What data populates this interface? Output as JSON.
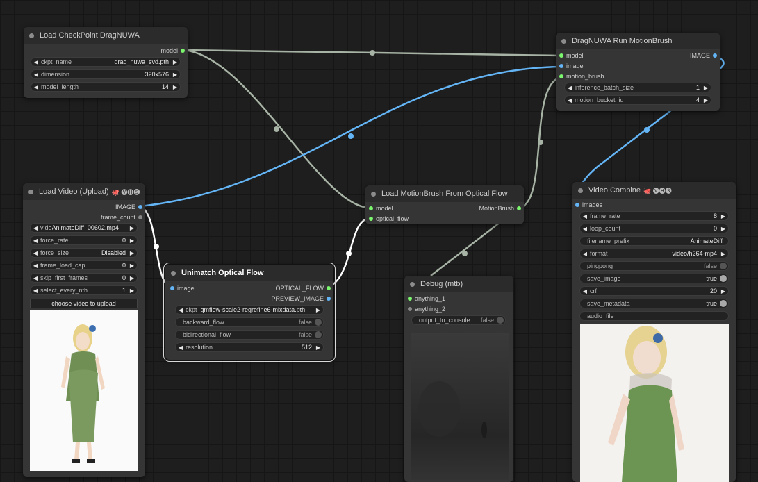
{
  "nodes": {
    "load_checkpoint": {
      "title": "Load CheckPoint DragNUWA",
      "outputs": [
        "model"
      ],
      "widgets": [
        {
          "label": "ckpt_name",
          "value": "drag_nuwa_svd.pth"
        },
        {
          "label": "dimension",
          "value": "320x576"
        },
        {
          "label": "model_length",
          "value": "14"
        }
      ]
    },
    "drag_run": {
      "title": "DragNUWA Run MotionBrush",
      "inputs": [
        "model",
        "image",
        "motion_brush"
      ],
      "outputs": [
        "IMAGE"
      ],
      "widgets": [
        {
          "label": "inference_batch_size",
          "value": "1"
        },
        {
          "label": "motion_bucket_id",
          "value": "4"
        }
      ]
    },
    "load_video": {
      "title": "Load Video (Upload)",
      "badge": "🐙 🅥🅗🅢",
      "outputs": [
        "IMAGE",
        "frame_count"
      ],
      "widgets": [
        {
          "label": "vide",
          "value": "AnimateDiff_00602.mp4"
        },
        {
          "label": "force_rate",
          "value": "0"
        },
        {
          "label": "force_size",
          "value": "Disabled"
        },
        {
          "label": "frame_load_cap",
          "value": "0"
        },
        {
          "label": "skip_first_frames",
          "value": "0"
        },
        {
          "label": "select_every_nth",
          "value": "1"
        }
      ],
      "upload_label": "choose video to upload"
    },
    "unimatch": {
      "title": "Unimatch Optical Flow",
      "inputs": [
        "image"
      ],
      "outputs": [
        "OPTICAL_FLOW",
        "PREVIEW_IMAGE"
      ],
      "ckpt": {
        "label": "ckpt_",
        "value": "gmflow-scale2-regrefine6-mixdata.pth"
      },
      "toggles": [
        {
          "label": "backward_flow",
          "value": "false"
        },
        {
          "label": "bidirectional_flow",
          "value": "false"
        }
      ],
      "resolution": {
        "label": "resolution",
        "value": "512"
      }
    },
    "load_motionbrush": {
      "title": "Load MotionBrush From Optical Flow",
      "inputs": [
        "model",
        "optical_flow"
      ],
      "outputs": [
        "MotionBrush"
      ]
    },
    "debug": {
      "title": "Debug (mtb)",
      "inputs": [
        "anything_1",
        "anything_2"
      ],
      "toggle": {
        "label": "output_to_console",
        "value": "false"
      }
    },
    "video_combine": {
      "title": "Video Combine",
      "badge": "🐙 🅥🅗🅢",
      "inputs": [
        "images"
      ],
      "widgets": [
        {
          "label": "frame_rate",
          "value": "8"
        },
        {
          "label": "loop_count",
          "value": "0"
        }
      ],
      "filename_prefix": {
        "label": "filename_prefix",
        "value": "AnimateDiff"
      },
      "format": {
        "label": "format",
        "value": "video/h264-mp4"
      },
      "toggles": [
        {
          "label": "pingpong",
          "value": "false"
        },
        {
          "label": "save_image",
          "value": "true"
        }
      ],
      "crf": {
        "label": "crf",
        "value": "20"
      },
      "save_metadata": {
        "label": "save_metadata",
        "value": "true"
      },
      "audio_file": {
        "label": "audio_file"
      }
    }
  },
  "colors": {
    "model_link": "#a7b3a4",
    "image_link": "#64b5f6",
    "flow_link": "#ffffff",
    "green_port": "#7cf56f",
    "blue_port": "#64b5f6"
  }
}
